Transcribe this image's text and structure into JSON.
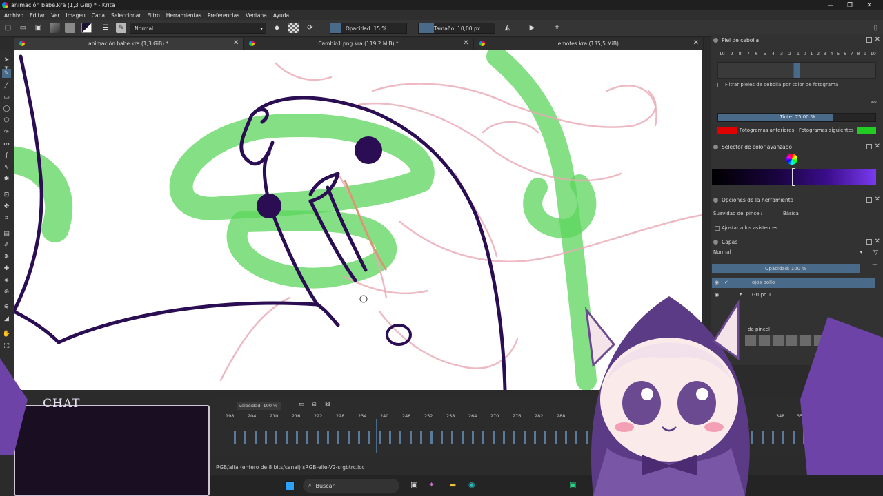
{
  "window": {
    "title": "animación babe.kra (1,3 GiB) * - Krita"
  },
  "menu": [
    "Archivo",
    "Editar",
    "Ver",
    "Imagen",
    "Capa",
    "Seleccionar",
    "Filtro",
    "Herramientas",
    "Preferencias",
    "Ventana",
    "Ayuda"
  ],
  "toolbar": {
    "blend_mode": "Normal",
    "opacity": "Opacidad: 15 %",
    "size": "Tamaño: 10,00 px"
  },
  "tabs": [
    {
      "label": "animación babe.kra (1,3 GiB) *"
    },
    {
      "label": "Cambio1.png.kra (119,2 MiB) *"
    },
    {
      "label": "emotes.kra (135,5 MiB)"
    }
  ],
  "onion": {
    "title": "Piel de cebolla",
    "numbers": [
      "-10",
      "-9",
      "-8",
      "-7",
      "-6",
      "-5",
      "-4",
      "-3",
      "-2",
      "-1",
      "0",
      "1",
      "2",
      "3",
      "4",
      "5",
      "6",
      "7",
      "8",
      "9",
      "10"
    ],
    "filter_label": "Filtrar pieles de cebolla por color de fotograma",
    "tint": "Tinte: 75,00 %",
    "prev_label": "Fotogramas anteriores",
    "next_label": "Fotogramas siguientes",
    "prev_color": "#e00000",
    "next_color": "#22cc22"
  },
  "color_selector": {
    "title": "Selector de color avanzado"
  },
  "tool_options": {
    "title": "Opciones de la herramienta",
    "smoothing_label": "Suavidad del pincel:",
    "smoothing_value": "Básica",
    "assist_label": "Ajustar a los asistentes"
  },
  "layers": {
    "title": "Capas",
    "blend": "Normal",
    "opacity": "Opacidad:  100 %",
    "items": [
      {
        "name": "ojos pollo"
      },
      {
        "name": "Grupo 1"
      }
    ]
  },
  "brushes": {
    "title": "de pincel"
  },
  "timeline": {
    "speed": "Velocidad: 100 %",
    "frames": [
      "198",
      "204",
      "210",
      "216",
      "222",
      "228",
      "234",
      "240",
      "246",
      "252",
      "258",
      "264",
      "270",
      "276",
      "282",
      "288",
      "348",
      "354"
    ]
  },
  "status": {
    "text": "RGB/alfa (entero de 8 bits/canal)  sRGB-elle-V2-srgbtrc.icc"
  },
  "taskbar": {
    "search": "Buscar"
  },
  "overlay": {
    "chat_label": "CHAT"
  },
  "colors": {
    "accent": "#4a6a8a",
    "stroke": "#2a0d52",
    "green": "#5cd65c",
    "pink": "#e9a9b4"
  }
}
